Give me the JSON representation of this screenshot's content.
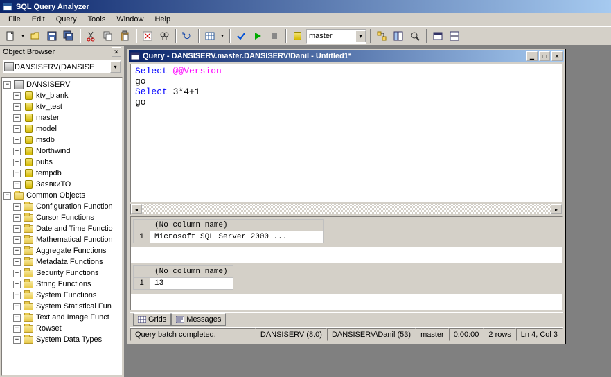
{
  "app": {
    "title": "SQL Query Analyzer"
  },
  "menu": {
    "file": "File",
    "edit": "Edit",
    "query": "Query",
    "tools": "Tools",
    "window": "Window",
    "help": "Help"
  },
  "toolbar": {
    "db_selected": "master"
  },
  "object_browser": {
    "title": "Object Browser",
    "server_combo": "DANSISERV(DANSISE",
    "server_node": "DANSISERV",
    "databases": [
      "ktv_blank",
      "ktv_test",
      "master",
      "model",
      "msdb",
      "Northwind",
      "pubs",
      "tempdb",
      "ЗаявкиТО"
    ],
    "common_header": "Common Objects",
    "common": [
      "Configuration Function",
      "Cursor Functions",
      "Date and Time Functio",
      "Mathematical Function",
      "Aggregate Functions",
      "Metadata Functions",
      "Security Functions",
      "String Functions",
      "System Functions",
      "System Statistical Fun",
      "Text and Image Funct",
      "Rowset",
      "System Data Types"
    ]
  },
  "query_window": {
    "title": "Query - DANSISERV.master.DANSISERV\\Danil - Untitled1*",
    "editor": {
      "line1_kw": "Select",
      "line1_gv": "@@Version",
      "line2": "go",
      "line3_kw": "Select",
      "line3_expr": "3*4+1",
      "line4": "go"
    },
    "results": {
      "no_col": "(No column name)",
      "r1": {
        "row": "1",
        "val": "Microsoft SQL Server  2000 ..."
      },
      "r2": {
        "row": "1",
        "val": "13"
      }
    },
    "tabs": {
      "grids": "Grids",
      "messages": "Messages"
    }
  },
  "status": {
    "msg": "Query batch completed.",
    "server": "DANSISERV (8.0)",
    "user": "DANSISERV\\Danil (53)",
    "db": "master",
    "time": "0:00:00",
    "rows": "2 rows",
    "pos": "Ln 4, Col 3"
  }
}
